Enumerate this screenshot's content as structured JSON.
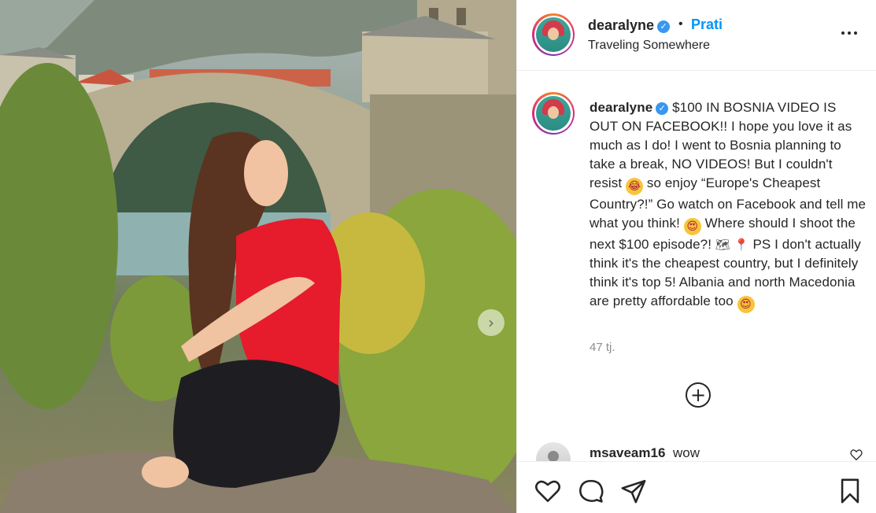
{
  "post": {
    "username": "dearalyne",
    "follow_label": "Prati",
    "separator": "•",
    "location": "Traveling Somewhere",
    "caption_user": "dearalyne",
    "caption_text_1": "$100 IN BOSNIA VIDEO IS OUT ON FACEBOOK!! I hope you love it as much as I do! I went to Bosnia planning to take a break, NO VIDEOS! But I couldn't resist",
    "caption_text_2": "so enjoy “Europe's Cheapest Country?!” Go watch on Facebook and tell me what you think!",
    "caption_text_3": "Where should I shoot the next $100 episode?!",
    "caption_text_4": "PS I don't actually think it's the cheapest country, but I definitely think it's top 5! Albania and north Macedonia are pretty affordable too",
    "timestamp": "47 tj.",
    "verified_mark": "✓"
  },
  "emojis": {
    "laugh": "😂",
    "hearts": "😍",
    "map": "🗺",
    "pin": "📍"
  },
  "comment": {
    "username": "msaveam16",
    "text": "wow"
  },
  "icons": {
    "next": "›",
    "plus": "+"
  }
}
